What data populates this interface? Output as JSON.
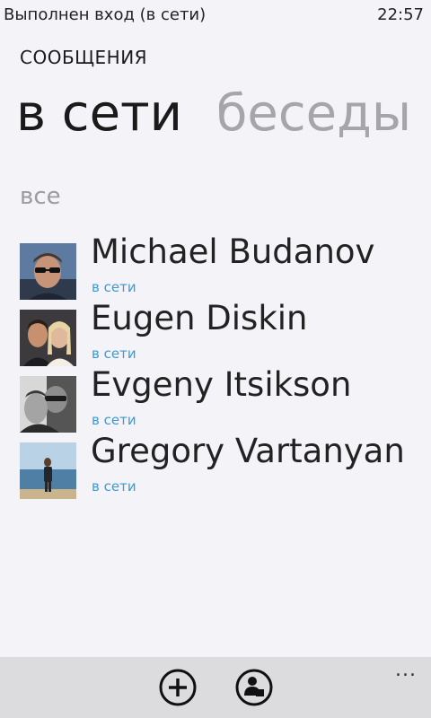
{
  "status_bar": {
    "text": "Выполнен вход (в сети)",
    "time": "22:57"
  },
  "header": {
    "title": "СООБЩЕНИЯ"
  },
  "pivot": {
    "tabs": [
      {
        "label": "в сети",
        "active": true
      },
      {
        "label": "беседы",
        "active": false
      }
    ]
  },
  "group": {
    "label": "все"
  },
  "contacts": [
    {
      "name": "Michael Budanov",
      "status": "в сети",
      "icon": "user-photo-icon"
    },
    {
      "name": "Eugen Diskin",
      "status": "в сети",
      "icon": "user-photo-icon"
    },
    {
      "name": "Evgeny Itsikson",
      "status": "в сети",
      "icon": "user-photo-icon"
    },
    {
      "name": "Gregory Vartanyan",
      "status": "в сети",
      "icon": "user-photo-icon"
    }
  ],
  "app_bar": {
    "buttons": [
      {
        "icon": "add-icon"
      },
      {
        "icon": "contact-icon"
      }
    ],
    "more": "..."
  },
  "colors": {
    "accent": "#3a9ad6",
    "background": "#f4f4f8",
    "appbar": "#dcdcdf",
    "inactive_tab": "#a6a6a9"
  }
}
